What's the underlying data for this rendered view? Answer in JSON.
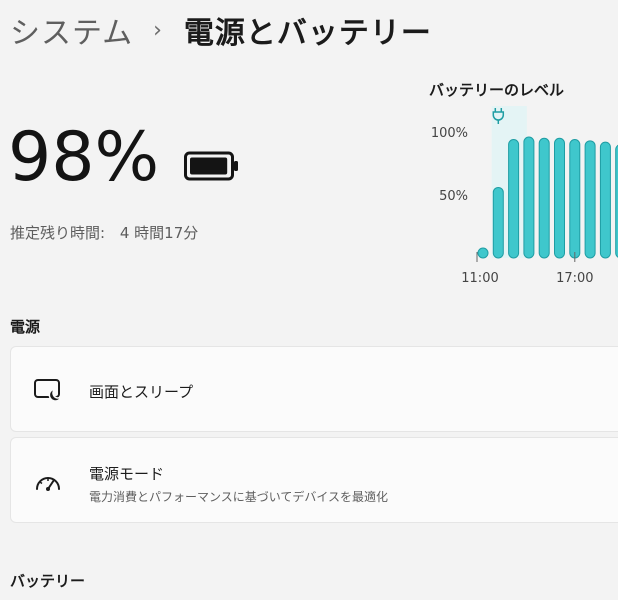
{
  "breadcrumb": {
    "parent": "システム",
    "chevron": "›",
    "current": "電源とバッテリー"
  },
  "battery": {
    "percent": "98%",
    "level": 0.98,
    "estimate_label": "推定残り時間:",
    "estimate_value": "4 時間17分"
  },
  "chart_data": {
    "type": "bar",
    "title": "バッテリーのレベル",
    "ylim": [
      0,
      100
    ],
    "yticks": [
      "100%",
      "50%"
    ],
    "ytick_values": [
      100,
      50
    ],
    "xtick_labels": [
      "11:00",
      "17:00"
    ],
    "xtick_indices": [
      0,
      6
    ],
    "values": [
      4,
      56,
      94,
      96,
      95,
      95,
      94,
      93,
      92,
      90
    ],
    "plugged_indices": [
      1
    ],
    "bar_color": "#3fc7cc",
    "bar_edge": "#1f9da3",
    "plug_icon": "plug-icon"
  },
  "sections": {
    "power": "電源",
    "battery": "バッテリー"
  },
  "cards": {
    "screen_sleep": {
      "title": "画面とスリープ",
      "icon": "screen-sleep-icon"
    },
    "power_mode": {
      "title": "電源モード",
      "subtitle": "電力消費とパフォーマンスに基づいてデバイスを最適化",
      "icon": "gauge-icon"
    }
  }
}
